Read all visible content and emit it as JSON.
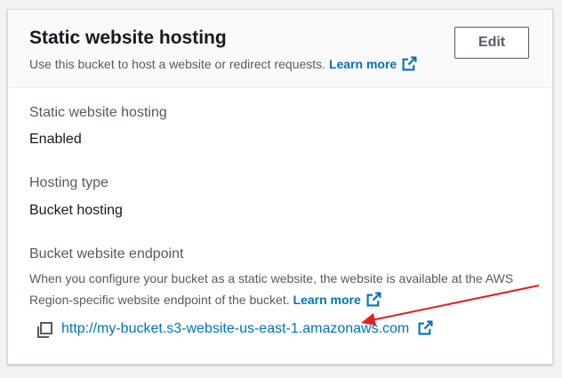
{
  "header": {
    "title": "Static website hosting",
    "description": "Use this bucket to host a website or redirect requests.",
    "learn_more": "Learn more",
    "edit_label": "Edit"
  },
  "fields": {
    "hosting": {
      "label": "Static website hosting",
      "value": "Enabled"
    },
    "hosting_type": {
      "label": "Hosting type",
      "value": "Bucket hosting"
    },
    "endpoint": {
      "label": "Bucket website endpoint",
      "description": "When you configure your bucket as a static website, the website is available at the AWS Region-specific website endpoint of the bucket.",
      "learn_more": "Learn more",
      "url": "http://my-bucket.s3-website-us-east-1.amazonaws.com"
    }
  },
  "icons": {
    "external": "external-link-icon",
    "copy": "copy-icon"
  },
  "colors": {
    "link": "#0073bb",
    "annotation_arrow": "#e02020"
  }
}
